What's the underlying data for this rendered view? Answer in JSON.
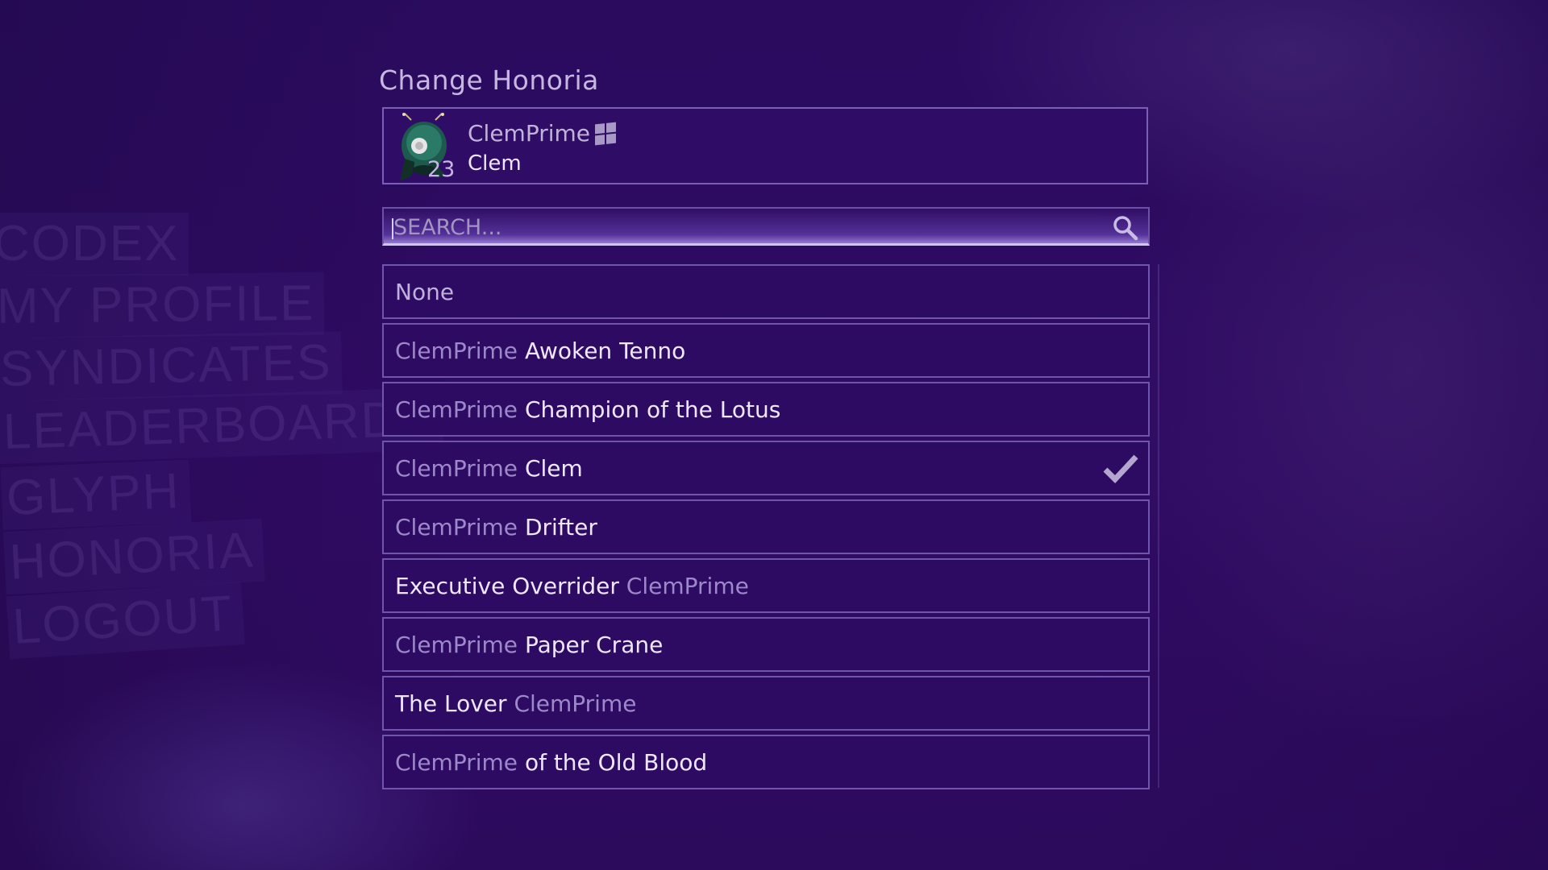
{
  "side_menu": {
    "items": [
      "CODEX",
      "MY PROFILE",
      "SYNDICATES",
      "LEADERBOARDS",
      "GLYPH",
      "HONORIA",
      "LOGOUT"
    ]
  },
  "panel": {
    "title": "Change Honoria",
    "profile": {
      "username": "ClemPrime",
      "platform_icon": "windows-icon",
      "mastery_rank": "23",
      "current_honoria": "Clem"
    },
    "search": {
      "placeholder": "SEARCH...",
      "value": ""
    },
    "honorias": [
      {
        "type": "none",
        "label": "None"
      },
      {
        "type": "suffix",
        "name": "ClemPrime",
        "title": "Awoken Tenno"
      },
      {
        "type": "suffix",
        "name": "ClemPrime",
        "title": "Champion of the Lotus"
      },
      {
        "type": "suffix",
        "name": "ClemPrime",
        "title": "Clem",
        "selected": true
      },
      {
        "type": "suffix",
        "name": "ClemPrime",
        "title": "Drifter"
      },
      {
        "type": "prefix",
        "title": "Executive Overrider",
        "name": "ClemPrime"
      },
      {
        "type": "suffix",
        "name": "ClemPrime",
        "title": "Paper Crane"
      },
      {
        "type": "prefix",
        "title": "The Lover",
        "name": "ClemPrime"
      },
      {
        "type": "suffix",
        "name": "ClemPrime",
        "title": "of the Old Blood"
      }
    ]
  },
  "colors": {
    "background": "#27095a",
    "row_bg": "#2d0b62",
    "row_border": "#6e55ad",
    "name_text": "#9d88c9",
    "title_text": "#efe7ff"
  }
}
